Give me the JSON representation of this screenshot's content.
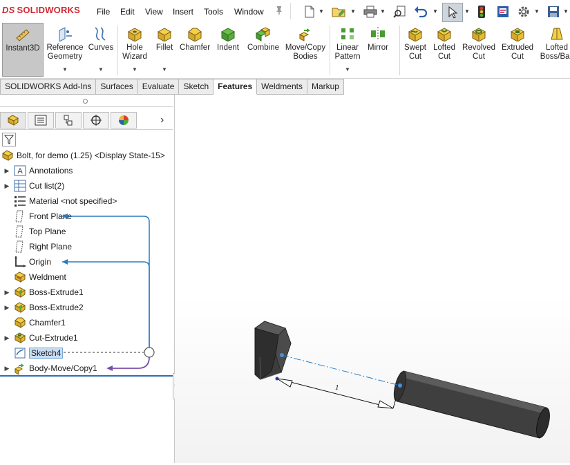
{
  "app": {
    "logo_text": "SOLIDWORKS",
    "logo_prefix": "DS",
    "brand_color": "#d22630"
  },
  "menu": [
    "File",
    "Edit",
    "View",
    "Insert",
    "Tools",
    "Window"
  ],
  "quick_access": [
    "new-icon",
    "open-icon",
    "print-icon",
    "find-icon",
    "undo-icon",
    "select-icon",
    "traffic-light-icon",
    "options-icon",
    "save-icon"
  ],
  "commands": [
    {
      "line1": "Instant3D",
      "line2": "",
      "icon": "instant3d-icon"
    },
    {
      "line1": "Reference",
      "line2": "Geometry",
      "icon": "reference-geometry-icon"
    },
    {
      "line1": "Curves",
      "line2": "",
      "icon": "curves-icon"
    },
    {
      "line1": "Hole",
      "line2": "Wizard",
      "icon": "hole-wizard-icon"
    },
    {
      "line1": "Fillet",
      "line2": "",
      "icon": "fillet-icon"
    },
    {
      "line1": "Chamfer",
      "line2": "",
      "icon": "chamfer-icon"
    },
    {
      "line1": "Indent",
      "line2": "",
      "icon": "indent-icon"
    },
    {
      "line1": "Combine",
      "line2": "",
      "icon": "combine-icon"
    },
    {
      "line1": "Move/Copy",
      "line2": "Bodies",
      "icon": "move-copy-icon"
    },
    {
      "line1": "Linear",
      "line2": "Pattern",
      "icon": "linear-pattern-icon"
    },
    {
      "line1": "Mirror",
      "line2": "",
      "icon": "mirror-icon"
    },
    {
      "line1": "Swept",
      "line2": "Cut",
      "icon": "swept-cut-icon"
    },
    {
      "line1": "Lofted",
      "line2": "Cut",
      "icon": "lofted-cut-icon"
    },
    {
      "line1": "Revolved",
      "line2": "Cut",
      "icon": "revolved-cut-icon"
    },
    {
      "line1": "Extruded",
      "line2": "Cut",
      "icon": "extruded-cut-icon"
    },
    {
      "line1": "Lofted",
      "line2": "Boss/Bas",
      "icon": "lofted-boss-icon"
    }
  ],
  "tabs": [
    "SOLIDWORKS Add-Ins",
    "Surfaces",
    "Evaluate",
    "Sketch",
    "Features",
    "Weldments",
    "Markup"
  ],
  "active_tab": "Features",
  "panel_tabs": [
    "feature-manager-icon",
    "property-manager-icon",
    "configuration-manager-icon",
    "dimxpert-icon",
    "display-manager-icon"
  ],
  "tree": {
    "root": "Bolt, for demo (1.25) <Display State-15>",
    "items": [
      {
        "label": "Annotations",
        "expandable": true,
        "icon": "annotations-icon"
      },
      {
        "label": "Cut list(2)",
        "expandable": true,
        "icon": "cut-list-icon"
      },
      {
        "label": "Material <not specified>",
        "expandable": false,
        "icon": "material-icon"
      },
      {
        "label": "Front Plane",
        "expandable": false,
        "icon": "plane-icon"
      },
      {
        "label": "Top Plane",
        "expandable": false,
        "icon": "plane-icon"
      },
      {
        "label": "Right Plane",
        "expandable": false,
        "icon": "plane-icon"
      },
      {
        "label": "Origin",
        "expandable": false,
        "icon": "origin-icon"
      },
      {
        "label": "Weldment",
        "expandable": false,
        "icon": "weldment-icon"
      },
      {
        "label": "Boss-Extrude1",
        "expandable": true,
        "icon": "boss-extrude-icon"
      },
      {
        "label": "Boss-Extrude2",
        "expandable": true,
        "icon": "boss-extrude-icon"
      },
      {
        "label": "Chamfer1",
        "expandable": false,
        "icon": "chamfer-feature-icon"
      },
      {
        "label": "Cut-Extrude1",
        "expandable": true,
        "icon": "cut-extrude-icon"
      },
      {
        "label": "Sketch4",
        "expandable": false,
        "icon": "sketch-icon",
        "selected": true
      },
      {
        "label": "Body-Move/Copy1",
        "expandable": true,
        "icon": "body-move-copy-icon"
      }
    ]
  },
  "colors": {
    "relation_blue": "#2a7bbf",
    "relation_purple": "#7a4fa6",
    "rollback_bar": "#2a6fb5",
    "selection": "#c7dcf1"
  },
  "viewport": {
    "dimension_label": "1"
  }
}
